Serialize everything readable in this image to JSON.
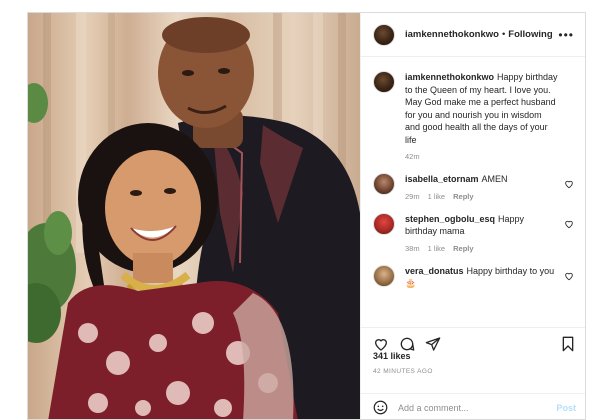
{
  "post": {
    "author": "iamkennethokonkwo",
    "follow_status": "Following",
    "more_label": "•••",
    "caption": {
      "username": "iamkennethokonkwo",
      "text": "Happy birthday to the Queen of my heart. I love you. May God make me a perfect husband for you and nourish you in wisdom and good health all the days of your life",
      "time": "42m"
    },
    "comments": [
      {
        "username": "isabella_etornam",
        "text": "AMEN",
        "time": "29m",
        "likes": "1 like",
        "reply": "Reply"
      },
      {
        "username": "stephen_ogbolu_esq",
        "text": "Happy birthday mama",
        "time": "38m",
        "likes": "1 like",
        "reply": "Reply"
      },
      {
        "username": "vera_donatus",
        "text": "Happy birthday to you 🎂",
        "time": "",
        "likes": "",
        "reply": ""
      }
    ],
    "likes_count": "341 likes",
    "posted_ago": "42 MINUTES AGO",
    "add_comment_placeholder": "Add a comment...",
    "post_label": "Post"
  },
  "icons": {
    "like": "heart-icon",
    "comment": "comment-icon",
    "share": "share-icon",
    "save": "bookmark-icon",
    "emoji": "smiley-icon",
    "more": "more-icon"
  },
  "colors": {
    "text": "#262626",
    "muted": "#8e8e8e",
    "border": "#efefef",
    "post_disabled": "#b2dffc"
  }
}
